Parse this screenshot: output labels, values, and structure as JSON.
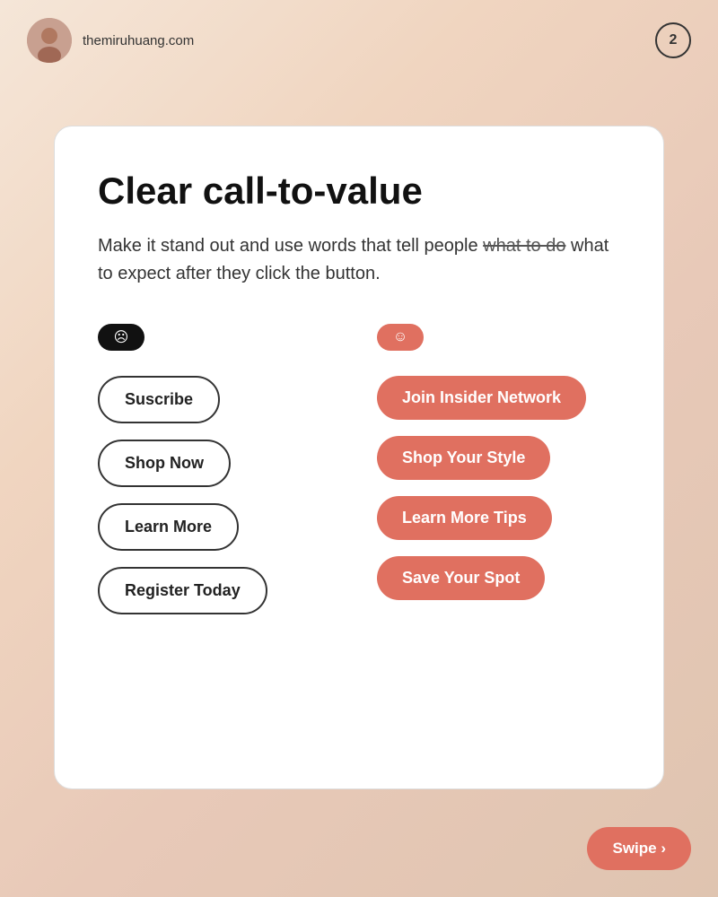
{
  "topbar": {
    "brand_name": "themiruhuang.com",
    "page_number": "2"
  },
  "card": {
    "title": "Clear call-to-value",
    "description_part1": "Make it stand out and use words that tell people ",
    "description_strikethrough": "what to do",
    "description_part2": " what to expect after they click the button.",
    "left_badge_emoji": "☹",
    "right_badge_emoji": "☺",
    "buttons_left": [
      {
        "label": "Suscribe"
      },
      {
        "label": "Shop Now"
      },
      {
        "label": "Learn More"
      },
      {
        "label": "Register Today"
      }
    ],
    "buttons_right": [
      {
        "label": "Join Insider Network"
      },
      {
        "label": "Shop Your Style"
      },
      {
        "label": "Learn More Tips"
      },
      {
        "label": "Save Your Spot"
      }
    ]
  },
  "swipe": {
    "label": "Swipe ›"
  }
}
